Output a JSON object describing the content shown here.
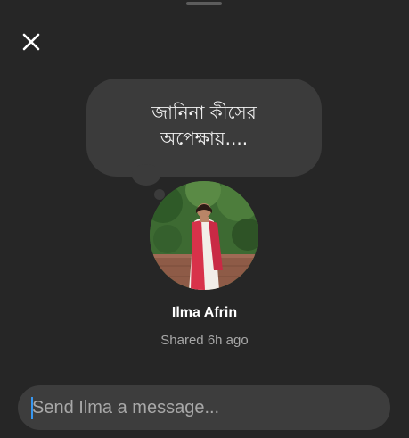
{
  "sheet": {
    "close_icon": "close-icon"
  },
  "note": {
    "text": "জানিনা কীসের অপেক্ষায়...."
  },
  "profile": {
    "username": "Ilma Afrin",
    "shared_text": "Shared 6h ago"
  },
  "composer": {
    "placeholder": "Send Ilma a message..."
  },
  "colors": {
    "background": "#262626",
    "bubble": "#3b3b3b",
    "input_background": "#3d3d3d",
    "caret": "#3797f0",
    "secondary_text": "#a8a8a8"
  }
}
